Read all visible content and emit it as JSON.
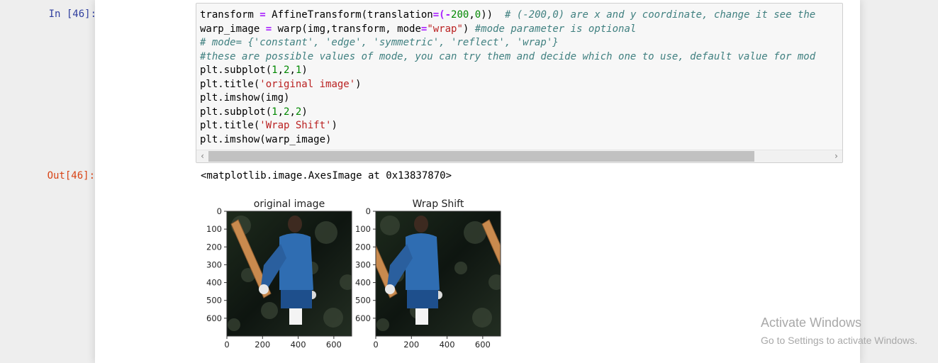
{
  "cell": {
    "in_prompt": "In [46]:",
    "out_prompt": "Out[46]:",
    "code_lines": [
      [
        [
          "",
          "transform "
        ],
        [
          "cm-operator",
          "="
        ],
        [
          "",
          " AffineTransform(translation"
        ],
        [
          "cm-operator",
          "=("
        ],
        [
          "cm-operator",
          "-"
        ],
        [
          "cm-number",
          "200"
        ],
        [
          "",
          ","
        ],
        [
          "cm-number",
          "0"
        ],
        [
          "",
          "))  "
        ],
        [
          "cm-comment",
          "# (-200,0) are x and y coordinate, change it see the"
        ]
      ],
      [
        [
          "",
          "warp_image "
        ],
        [
          "cm-operator",
          "="
        ],
        [
          "",
          " warp(img,transform, mode"
        ],
        [
          "cm-operator",
          "="
        ],
        [
          "cm-string",
          "\"wrap\""
        ],
        [
          "",
          ") "
        ],
        [
          "cm-comment",
          "#mode parameter is optional"
        ]
      ],
      [
        [
          "cm-comment",
          "# mode= {'constant', 'edge', 'symmetric', 'reflect', 'wrap'}"
        ]
      ],
      [
        [
          "cm-comment",
          "#these are possible values of mode, you can try them and decide which one to use, default value for mod"
        ]
      ],
      [
        [
          "",
          "plt.subplot("
        ],
        [
          "cm-number",
          "1"
        ],
        [
          "",
          ","
        ],
        [
          "cm-number",
          "2"
        ],
        [
          "",
          ","
        ],
        [
          "cm-number",
          "1"
        ],
        [
          "",
          ")"
        ]
      ],
      [
        [
          "",
          "plt.title("
        ],
        [
          "cm-string",
          "'original image'"
        ],
        [
          "",
          ")"
        ]
      ],
      [
        [
          "",
          "plt.imshow(img)"
        ]
      ],
      [
        [
          "",
          "plt.subplot("
        ],
        [
          "cm-number",
          "1"
        ],
        [
          "",
          ","
        ],
        [
          "cm-number",
          "2"
        ],
        [
          "",
          ","
        ],
        [
          "cm-number",
          "2"
        ],
        [
          "",
          ")"
        ]
      ],
      [
        [
          "",
          "plt.title("
        ],
        [
          "cm-string",
          "'Wrap Shift'"
        ],
        [
          "",
          ")"
        ]
      ],
      [
        [
          "",
          "plt.imshow(warp_image)"
        ]
      ]
    ],
    "output_text": "<matplotlib.image.AxesImage at 0x13837870>",
    "scroll_left_icon": "chevron-left-icon",
    "scroll_right_icon": "chevron-right-icon"
  },
  "figure": {
    "subplots": [
      {
        "title": "original image",
        "xticks": [
          "0",
          "200",
          "400",
          "600"
        ],
        "yticks": [
          "0",
          "100",
          "200",
          "300",
          "400",
          "500",
          "600"
        ]
      },
      {
        "title": "Wrap Shift",
        "xticks": [
          "0",
          "200",
          "400",
          "600"
        ],
        "yticks": [
          "0",
          "100",
          "200",
          "300",
          "400",
          "500",
          "600"
        ]
      }
    ]
  },
  "watermark": {
    "title": "Activate Windows",
    "subtitle": "Go to Settings to activate Windows."
  }
}
